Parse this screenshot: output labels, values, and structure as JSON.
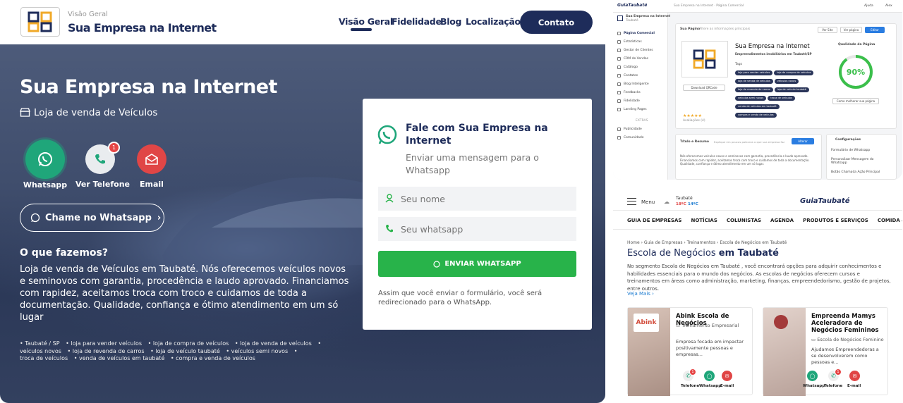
{
  "main": {
    "header": {
      "breadcrumb": "Visão Geral",
      "title": "Sua Empresa na Internet",
      "nav": [
        "Visão Geral",
        "Fidelidade",
        "Blog",
        "Localização"
      ],
      "contact_button": "Contato"
    },
    "hero": {
      "title": "Sua Empresa na Internet",
      "subtitle": "Loja de venda de Veículos",
      "actions": [
        {
          "label": "Whatsapp",
          "icon": "whatsapp-icon",
          "color": "#1fa67a"
        },
        {
          "label": "Ver Telefone",
          "icon": "phone-icon",
          "color": "#e9ecef",
          "badge": "1"
        },
        {
          "label": "Email",
          "icon": "email-icon",
          "color": "#e04646"
        }
      ],
      "whatsapp_cta": "Chame no Whatsapp",
      "what_we_do_heading": "O que fazemos?",
      "description": "Loja de venda de Veículos em Taubaté. Nós oferecemos veículos novos e seminovos com garantia, procedência e laudo aprovado. Financiamos com rapidez, aceitamos troca com troco e cuidamos de toda a documentação. Qualidade, confiança e ótimo atendimento em um só lugar",
      "tags": [
        "Taubaté / SP",
        "loja para vender veículos",
        "loja de compra de veículos",
        "loja de venda de veículos",
        "veículos novos",
        "loja de revenda de carros",
        "loja de veículo taubaté",
        "veículos semi novos",
        "troca de veículos",
        "venda de veículos em taubaté",
        "compra e venda de veículos"
      ]
    },
    "form": {
      "title": "Fale com Sua Empresa na Internet",
      "subtitle": "Enviar uma mensagem para o Whatsapp",
      "name_placeholder": "Seu nome",
      "whatsapp_placeholder": "Seu whatsapp",
      "submit": "ENVIAR WHATSAPP",
      "note": "Assim que você enviar o formulário, você será redirecionado para o WhatsApp."
    }
  },
  "dashboard": {
    "logo_text": "GuiaTaubaté",
    "top_breadcrumb": "Sua Empresa na Internet · Página Comercial",
    "help": "Ajuda",
    "user": "Alex",
    "account_name": "Sua Empresa na Internet",
    "account_city": "Taubaté",
    "menu": [
      "Página Comercial",
      "Estatísticas",
      "Gestor de Clientes",
      "CRM de Vendas",
      "Catálogo",
      "Contatos",
      "Blog Inteligente",
      "Feedbacks",
      "Fidelidade",
      "Landing Pages"
    ],
    "menu_section": "EXTRAS",
    "extras": [
      "Publicidade",
      "Comunidade"
    ],
    "page_header": "Sua Página",
    "page_header_hint": "Altere as informações principais",
    "btn_view_site": "Ver Site",
    "btn_view_page": "Ver página",
    "btn_edit": "Editar",
    "company_name": "Sua Empresa na Internet",
    "company_desc": "Empreendimentos imobiliários em Taubaté/SP",
    "tags_label": "Tags",
    "tags": [
      "loja para vender veículos",
      "loja de compra de veículos",
      "loja de venda de veículos",
      "veículos novos",
      "loja de revenda de carros",
      "loja de veículo taubaté",
      "veículos semi novos",
      "troca de veículos",
      "venda de veículos em taubaté",
      "compra e venda de veículos"
    ],
    "download_qr": "Download QRCode",
    "reviews": "Avaliações (4)",
    "quality_label": "Qualidade da Página",
    "quality_value": "90%",
    "quality_fraction": 0.9,
    "improve_btn": "Como melhorar sua página",
    "summary_title": "Título e Resumo",
    "summary_hint": "Explique em poucas palavras o que sua empresa faz",
    "summary_btn": "Alterar",
    "summary_text": "Nós oferecemos veículos novos e seminovos com garantia, procedência e laudo aprovado. Financiamos com rapidez, aceitamos troca com troco e cuidamos de toda a documentação. Qualidade, confiança e ótimo atendimento em um só lugar.",
    "settings_title": "Configurações",
    "settings": [
      "Formulário de Whatsapp",
      "Personalizar Mensagem do Whatsapp",
      "Botão Chamada Ação Principal"
    ]
  },
  "guia": {
    "menu": "Menu",
    "city": "Taubaté",
    "temp_min": "18ºC",
    "temp_max": "14ºC",
    "logo_text": "GuiaTaubaté",
    "categories": [
      "GUIA DE EMPRESAS",
      "NOTÍCIAS",
      "COLUNISTAS",
      "AGENDA",
      "PRODUTOS E SERVIÇOS",
      "COMIDA & DELIVERY",
      "IMÓVEIS"
    ],
    "breadcrumb": "Home  ›  Guia de Empresas  ›  Treinamentos  ›  Escola de Negócios em Taubaté",
    "title_prefix": "Escola de Negócios",
    "title_suffix": "em Taubaté",
    "description": "No segmento Escola de Negócios em Taubaté , você encontrará opções para adquirir conhecimentos e habilidades essenciais para o mundo dos negócios. As escolas de negócios oferecem cursos e treinamentos em áreas como administração, marketing, finanças, empreendedorismo, gestão de projetos, entre outros.",
    "see_more": "Veja Mais ›",
    "cards": [
      {
        "name": "Abink Escola de Negócios",
        "category": "Treinamento Empresarial",
        "desc": "Empresa focada em impactar positivamente pessoas e empresas...",
        "logo_text": "Abink",
        "actions": [
          "Telefone",
          "Whatsapp",
          "E-mail"
        ]
      },
      {
        "name": "Empreenda Mamys Aceleradora de Negócios Femininos",
        "category": "Escola de Negócios Feminino",
        "desc": "Ajudamos Empreendedoras a se desenvolverem como pessoas e...",
        "actions": [
          "Whatsapp",
          "Telefone",
          "E-mail"
        ]
      }
    ]
  }
}
